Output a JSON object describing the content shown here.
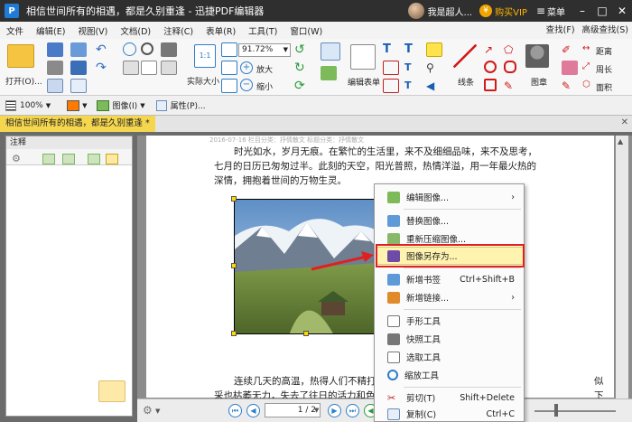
{
  "titlebar": {
    "doc_title": "相信世间所有的相遇，都是久别重逢",
    "separator": " - ",
    "app_name": "迅捷PDF编辑器",
    "user_name": "我是超人...",
    "vip_label": "购买VIP",
    "menu_label": "菜单"
  },
  "menubar": {
    "items": [
      "文件",
      "编辑(E)",
      "视图(V)",
      "文档(D)",
      "注释(C)",
      "表单(R)",
      "工具(T)",
      "窗口(W)"
    ],
    "find_label": "查找(F)",
    "advanced_find_label": "高级查找(S)"
  },
  "toolbar": {
    "open_label": "打开(O)...",
    "zoom_value": "91.72%",
    "actual_size_label": "实际大小",
    "zoom_in_label": "放大",
    "zoom_out_label": "缩小",
    "edit_form_label": "编辑表单",
    "lines_label": "线条",
    "stamp_label": "图章",
    "distance_label": "距离",
    "perimeter_label": "周长",
    "area_label": "面积"
  },
  "toolbar2": {
    "zoom_pct": "100%",
    "image_label": "图像(I)",
    "properties_label": "属性(P)..."
  },
  "tab": {
    "label": "相信世间所有的相遇，都是久别重逢 *"
  },
  "sidebar": {
    "title": "注释"
  },
  "document": {
    "meta": "2016-07-16  栏目分类：抒情散文   标题分类：抒情散文",
    "paragraph1": "时光如水，岁月无痕。在繁忙的生活里，来不及细细品味，来不及思考，七月的日历已匆匆过半。此刻的天空，阳光普照，热情洋溢，用一年最火热的深情，拥抱着世间的万物生灵。",
    "line1": "时光如水，岁月无痕。在繁忙的生活里，来不及细细品味，来不及思考，",
    "line2": "七月的日历已匆匆过半。此刻的天空，阳光普照，热情洋溢，用一年最火热的",
    "line3": "深情，拥抱着世间的万物生灵。",
    "line4": "连续几天的高温，热得人们不精打",
    "line5": "采也枯萎无力，失去了往日的活力和色",
    "tail4": "似",
    "tail5": "下"
  },
  "context_menu": {
    "items": [
      {
        "label": "编辑图像...",
        "shortcut": "",
        "submenu": true
      },
      {
        "label": "替换图像...",
        "shortcut": "",
        "submenu": false
      },
      {
        "label": "重新压缩图像...",
        "shortcut": "",
        "submenu": false
      },
      {
        "label": "图像另存为...",
        "shortcut": "",
        "submenu": false,
        "highlighted": true
      },
      {
        "label": "新增书签",
        "shortcut": "Ctrl+Shift+B",
        "submenu": false
      },
      {
        "label": "新增链接...",
        "shortcut": "",
        "submenu": true
      },
      {
        "label": "手形工具",
        "shortcut": "",
        "submenu": false
      },
      {
        "label": "快照工具",
        "shortcut": "",
        "submenu": false
      },
      {
        "label": "选取工具",
        "shortcut": "",
        "submenu": false
      },
      {
        "label": "缩放工具",
        "shortcut": "",
        "submenu": false
      },
      {
        "label": "剪切(T)",
        "shortcut": "Shift+Delete",
        "submenu": false
      },
      {
        "label": "复制(C)",
        "shortcut": "Ctrl+C",
        "submenu": false
      }
    ]
  },
  "navigation": {
    "page_display": "1 / 2"
  },
  "colors": {
    "highlight_border": "#e02020",
    "menu_highlight": "#fff3b0",
    "tab_active": "#f5d64f",
    "title_bar": "#2f2f2f"
  }
}
